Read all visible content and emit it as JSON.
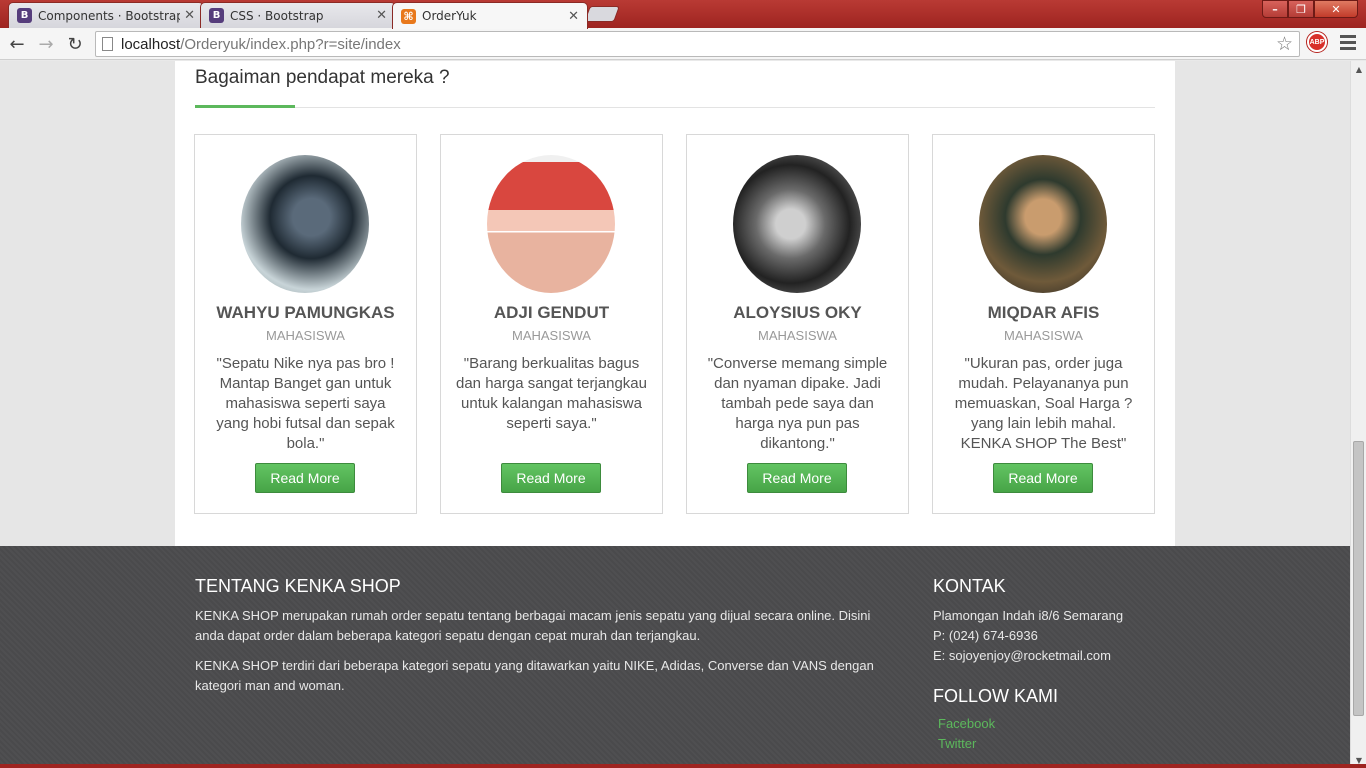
{
  "browser": {
    "tabs": [
      {
        "label": "Components · Bootstrap",
        "favicon": "bootstrap-icon",
        "favicon_text": "B"
      },
      {
        "label": "CSS · Bootstrap",
        "favicon": "bootstrap-icon",
        "favicon_text": "B"
      },
      {
        "label": "OrderYuk",
        "favicon": "orderyuk-icon",
        "favicon_text": "⌘"
      }
    ],
    "active_tab": 2,
    "url_host": "localhost",
    "url_path": "/Orderyuk/index.php?r=site/index",
    "abp_label": "ABP"
  },
  "testimonials": {
    "title": "Bagaiman pendapat mereka ?",
    "accent_color": "#5cb85c",
    "items": [
      {
        "name": "WAHYU PAMUNGKAS",
        "role": "MAHASISWA",
        "quote": "\"Sepatu Nike nya pas bro ! Mantap Banget gan untuk mahasiswa seperti saya yang hobi futsal dan sepak bola.\"",
        "button": "Read More"
      },
      {
        "name": "ADJI GENDUT",
        "role": "MAHASISWA",
        "quote": "\"Barang berkualitas bagus dan harga sangat terjangkau untuk kalangan mahasiswa seperti saya.\"",
        "button": "Read More"
      },
      {
        "name": "ALOYSIUS OKY",
        "role": "MAHASISWA",
        "quote": "\"Converse memang simple dan nyaman dipake. Jadi tambah pede saya dan harga nya pun pas dikantong.\"",
        "button": "Read More"
      },
      {
        "name": "MIQDAR AFIS",
        "role": "MAHASISWA",
        "quote": "\"Ukuran pas, order juga mudah. Pelayananya pun memuaskan, Soal Harga ? yang lain lebih mahal. KENKA SHOP The Best\"",
        "button": "Read More"
      }
    ]
  },
  "footer": {
    "about_title": "TENTANG KENKA SHOP",
    "about_p1": "KENKA SHOP merupakan rumah order sepatu tentang berbagai macam jenis sepatu yang dijual secara online. Disini anda dapat order dalam beberapa kategori sepatu dengan cepat murah dan terjangkau.",
    "about_p2": "KENKA SHOP terdiri dari beberapa kategori sepatu yang ditawarkan yaitu NIKE, Adidas, Converse dan VANS dengan kategori man and woman.",
    "contact_title": "KONTAK",
    "address": "Plamongan Indah i8/6 Semarang",
    "phone": "P: (024) 674-6936",
    "email": "E: sojoyenjoy@rocketmail.com",
    "follow_title": "FOLLOW KAMI",
    "links": [
      "Facebook",
      "Twitter"
    ]
  }
}
